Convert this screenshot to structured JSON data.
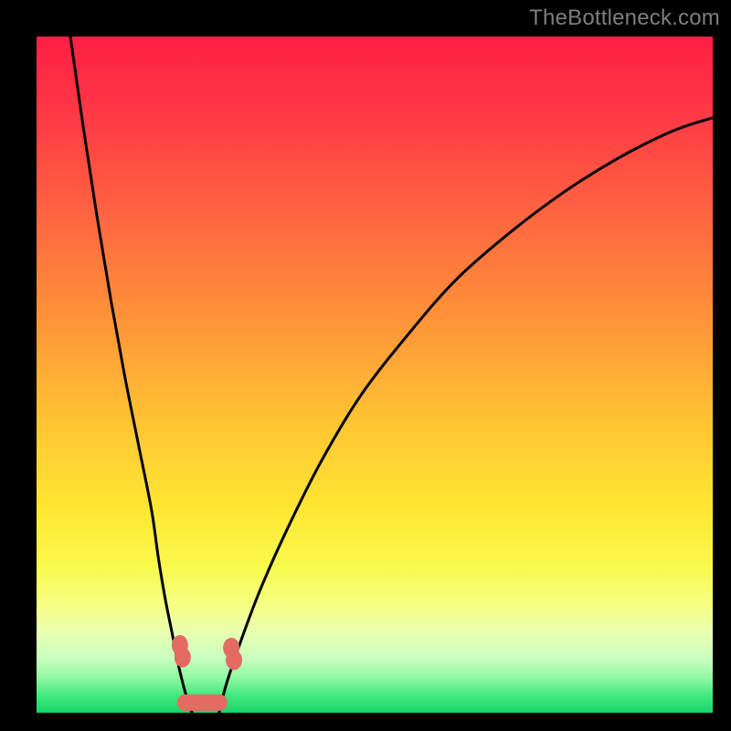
{
  "attribution": "TheBottleneck.com",
  "chart_data": {
    "type": "line",
    "title": "",
    "xlabel": "",
    "ylabel": "",
    "xlim": [
      0,
      100
    ],
    "ylim": [
      0,
      100
    ],
    "grid": false,
    "legend": false,
    "background_gradient": {
      "stops": [
        {
          "offset": 0.0,
          "color": "#ff1f44"
        },
        {
          "offset": 0.12,
          "color": "#ff3a45"
        },
        {
          "offset": 0.28,
          "color": "#ff6a3f"
        },
        {
          "offset": 0.44,
          "color": "#ff9a38"
        },
        {
          "offset": 0.58,
          "color": "#ffc733"
        },
        {
          "offset": 0.7,
          "color": "#ffe733"
        },
        {
          "offset": 0.78,
          "color": "#f8f84a"
        },
        {
          "offset": 0.84,
          "color": "#f6ff82"
        },
        {
          "offset": 0.88,
          "color": "#e9ffb0"
        },
        {
          "offset": 0.92,
          "color": "#c8ffc0"
        },
        {
          "offset": 0.95,
          "color": "#8cf7a0"
        },
        {
          "offset": 0.975,
          "color": "#3fe97e"
        },
        {
          "offset": 1.0,
          "color": "#17d36a"
        }
      ]
    },
    "series": [
      {
        "name": "left-branch",
        "x": [
          5,
          7,
          9,
          11,
          13,
          15,
          17,
          18,
          19,
          20,
          21,
          22,
          23
        ],
        "y": [
          100,
          86,
          73,
          61,
          50,
          40,
          30,
          23,
          17,
          12,
          7,
          3,
          0
        ]
      },
      {
        "name": "right-branch",
        "x": [
          27,
          28,
          30,
          33,
          37,
          42,
          48,
          55,
          62,
          70,
          78,
          86,
          94,
          100
        ],
        "y": [
          0,
          4,
          10,
          18,
          27,
          37,
          47,
          56,
          64,
          71,
          77,
          82,
          86,
          88
        ]
      }
    ],
    "markers": [
      {
        "shape": "blob",
        "x": 21.2,
        "y": 10.0,
        "color": "#e46b62"
      },
      {
        "shape": "blob",
        "x": 21.6,
        "y": 8.2,
        "color": "#e46b62"
      },
      {
        "shape": "blob",
        "x": 28.8,
        "y": 9.6,
        "color": "#e46b62"
      },
      {
        "shape": "blob",
        "x": 29.2,
        "y": 7.8,
        "color": "#e46b62"
      },
      {
        "shape": "pill",
        "x": 24.5,
        "y": 1.5,
        "w": 7.5,
        "color": "#e46b62"
      }
    ]
  }
}
